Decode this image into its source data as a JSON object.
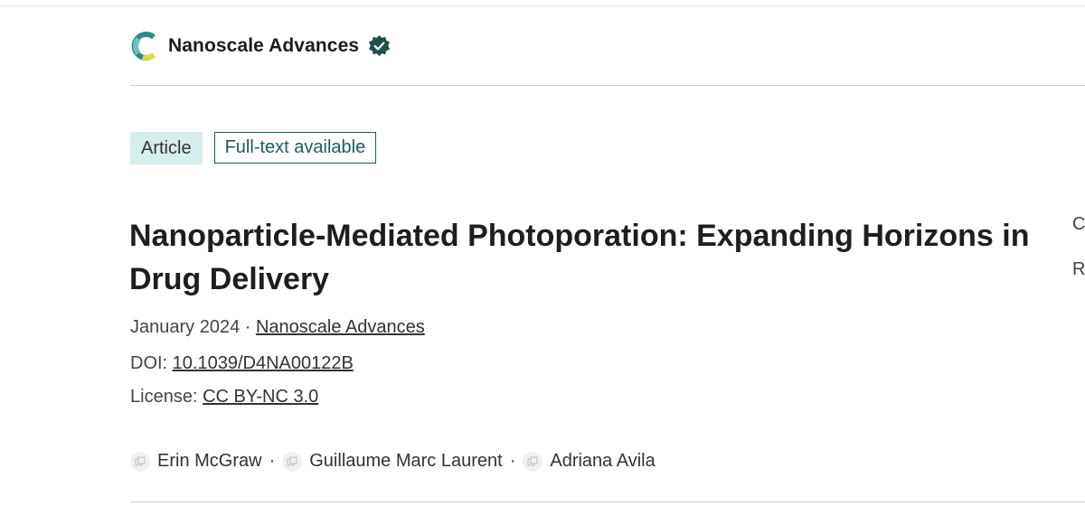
{
  "journal": {
    "name": "Nanoscale Advances"
  },
  "badges": {
    "article": "Article",
    "fulltext": "Full-text available"
  },
  "article": {
    "title": "Nanoparticle-Mediated Photoporation: Expanding Horizons in Drug Delivery",
    "date": "January 2024",
    "separator": " · ",
    "journal_link": "Nanoscale Advances",
    "doi_label": "DOI: ",
    "doi": "10.1039/D4NA00122B",
    "license_label": "License: ",
    "license": "CC BY-NC 3.0"
  },
  "authors": [
    {
      "name": "Erin McGraw"
    },
    {
      "name": "Guillaume Marc Laurent"
    },
    {
      "name": "Adriana Avila"
    }
  ],
  "author_separator": "·",
  "side_panel": {
    "line1": "C",
    "line2": "R"
  },
  "colors": {
    "accent": "#1f5a58",
    "badge_bg": "#d7eeee"
  }
}
